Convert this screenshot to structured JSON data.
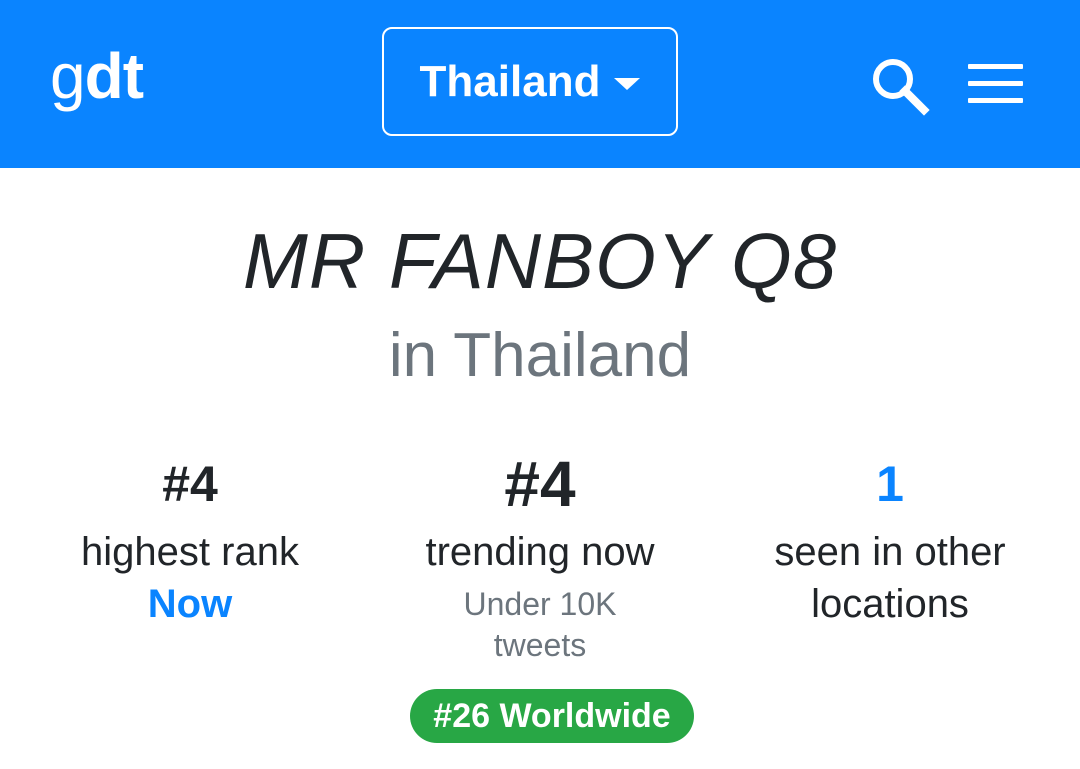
{
  "header": {
    "logo_g": "g",
    "logo_dt": "dt",
    "location_label": "Thailand",
    "search_icon": "search-icon",
    "menu_icon": "hamburger-menu-icon",
    "background_color": "#0a84ff"
  },
  "trend": {
    "title": "MR FANBOY Q8",
    "subtitle": "in Thailand"
  },
  "stats": {
    "highest_rank": {
      "value": "#4",
      "label": "highest rank",
      "when": "Now"
    },
    "trending_now": {
      "value": "#4",
      "label": "trending now",
      "tweets_line1": "Under 10K",
      "tweets_line2": "tweets"
    },
    "other_locations": {
      "value": "1",
      "label_line1": "seen in other",
      "label_line2": "locations"
    }
  },
  "worldwide_badge": "#26 Worldwide",
  "colors": {
    "accent": "#0a84ff",
    "badge_green": "#28a745",
    "muted": "#6c757d",
    "text": "#212529"
  }
}
